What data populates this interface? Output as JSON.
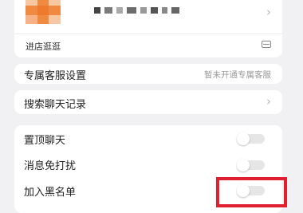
{
  "profile": {
    "avatar_icon": "blurred-avatar",
    "name_icon": "blurred-name",
    "chevron": "›",
    "store_label": "进店逛逛",
    "store_icon": "storefront-icon"
  },
  "service": {
    "label": "专属客服设置",
    "value": "暂未开通专属客服"
  },
  "search": {
    "label": "搜索聊天记录",
    "chevron": "›"
  },
  "settings": [
    {
      "label": "置顶聊天",
      "on": false
    },
    {
      "label": "消息免打扰",
      "on": false
    },
    {
      "label": "加入黑名单",
      "on": false
    }
  ],
  "colors": {
    "highlight": "#e1202f",
    "avatar_orange": "#f2843a"
  }
}
